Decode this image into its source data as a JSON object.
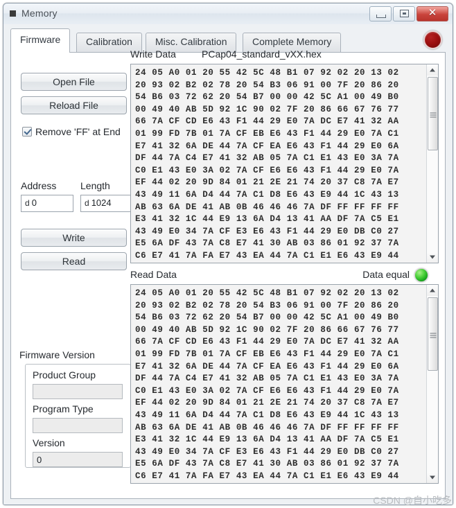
{
  "window": {
    "title": "Memory",
    "icon": "app-square-icon",
    "controls": {
      "minimize": "─",
      "maximize": "□",
      "close": "✕"
    }
  },
  "tabs": [
    {
      "label": "Firmware",
      "active": true
    },
    {
      "label": "Calibration",
      "active": false
    },
    {
      "label": "Misc. Calibration",
      "active": false
    },
    {
      "label": "Complete Memory",
      "active": false
    }
  ],
  "status_led": {
    "name": "connection-status-led",
    "color": "#9d0f0f",
    "state": "red"
  },
  "left_panel": {
    "open_file_label": "Open File",
    "reload_file_label": "Reload File",
    "remove_ff_label": "Remove 'FF' at End",
    "remove_ff_checked": true,
    "address_label": "Address",
    "address_radix": "d",
    "address_value": "0",
    "length_label": "Length",
    "length_radix": "d",
    "length_value": "1024",
    "write_label": "Write",
    "read_label": "Read"
  },
  "firmware_version": {
    "group_label": "Firmware Version",
    "fields": [
      {
        "label": "Product Group",
        "value": ""
      },
      {
        "label": "Program Type",
        "value": ""
      },
      {
        "label": "Version",
        "value": "0"
      }
    ]
  },
  "write_data": {
    "label": "Write Data",
    "filename": "PCap04_standard_vXX.hex",
    "lines": [
      "24 05 A0 01 20 55 42 5C 48 B1 07 92 02 20 13 02",
      "20 93 02 B2 02 78 20 54 B3 06 91 00 7F 20 86 20",
      "54 B6 03 72 62 20 54 B7 00 00 42 5C A1 00 49 B0",
      "00 49 40 AB 5D 92 1C 90 02 7F 20 86 66 67 76 77",
      "66 7A CF CD E6 43 F1 44 29 E0 7A DC E7 41 32 AA",
      "01 99 FD 7B 01 7A CF EB E6 43 F1 44 29 E0 7A C1",
      "E7 41 32 6A DE 44 7A CF EA E6 43 F1 44 29 E0 6A",
      "DF 44 7A C4 E7 41 32 AB 05 7A C1 E1 43 E0 3A 7A",
      "C0 E1 43 E0 3A 02 7A CF E6 E6 43 F1 44 29 E0 7A",
      "EF 44 02 20 9D 84 01 21 2E 21 74 20 37 C8 7A E7",
      "43 49 11 6A D4 44 7A C1 D8 E6 43 E9 44 1C 43 13",
      "AB 63 6A DE 41 AB 0B 46 46 46 7A DF FF FF FF FF",
      "E3 41 32 1C 44 E9 13 6A D4 13 41 AA DF 7A C5 E1",
      "43 49 E0 34 7A CF E3 E6 43 F1 44 29 E0 DB C0 27",
      "E5 6A DF 43 7A C8 E7 41 30 AB 03 86 01 92 37 7A",
      "C6 E7 41 7A FA E7 43 EA 44 7A C1 E1 E6 43 E9 44"
    ]
  },
  "read_data": {
    "label": "Read Data",
    "equal_label": "Data equal",
    "equal_state": "green",
    "lines": [
      "24 05 A0 01 20 55 42 5C 48 B1 07 92 02 20 13 02",
      "20 93 02 B2 02 78 20 54 B3 06 91 00 7F 20 86 20",
      "54 B6 03 72 62 20 54 B7 00 00 42 5C A1 00 49 B0",
      "00 49 40 AB 5D 92 1C 90 02 7F 20 86 66 67 76 77",
      "66 7A CF CD E6 43 F1 44 29 E0 7A DC E7 41 32 AA",
      "01 99 FD 7B 01 7A CF EB E6 43 F1 44 29 E0 7A C1",
      "E7 41 32 6A DE 44 7A CF EA E6 43 F1 44 29 E0 6A",
      "DF 44 7A C4 E7 41 32 AB 05 7A C1 E1 43 E0 3A 7A",
      "C0 E1 43 E0 3A 02 7A CF E6 E6 43 F1 44 29 E0 7A",
      "EF 44 02 20 9D 84 01 21 2E 21 74 20 37 C8 7A E7",
      "43 49 11 6A D4 44 7A C1 D8 E6 43 E9 44 1C 43 13",
      "AB 63 6A DE 41 AB 0B 46 46 46 7A DF FF FF FF FF",
      "E3 41 32 1C 44 E9 13 6A D4 13 41 AA DF 7A C5 E1",
      "43 49 E0 34 7A CF E3 E6 43 F1 44 29 E0 DB C0 27",
      "E5 6A DF 43 7A C8 E7 41 30 AB 03 86 01 92 37 7A",
      "C6 E7 41 7A FA E7 43 EA 44 7A C1 E1 E6 43 E9 44"
    ]
  },
  "watermark": "CSDN @自小吃多"
}
